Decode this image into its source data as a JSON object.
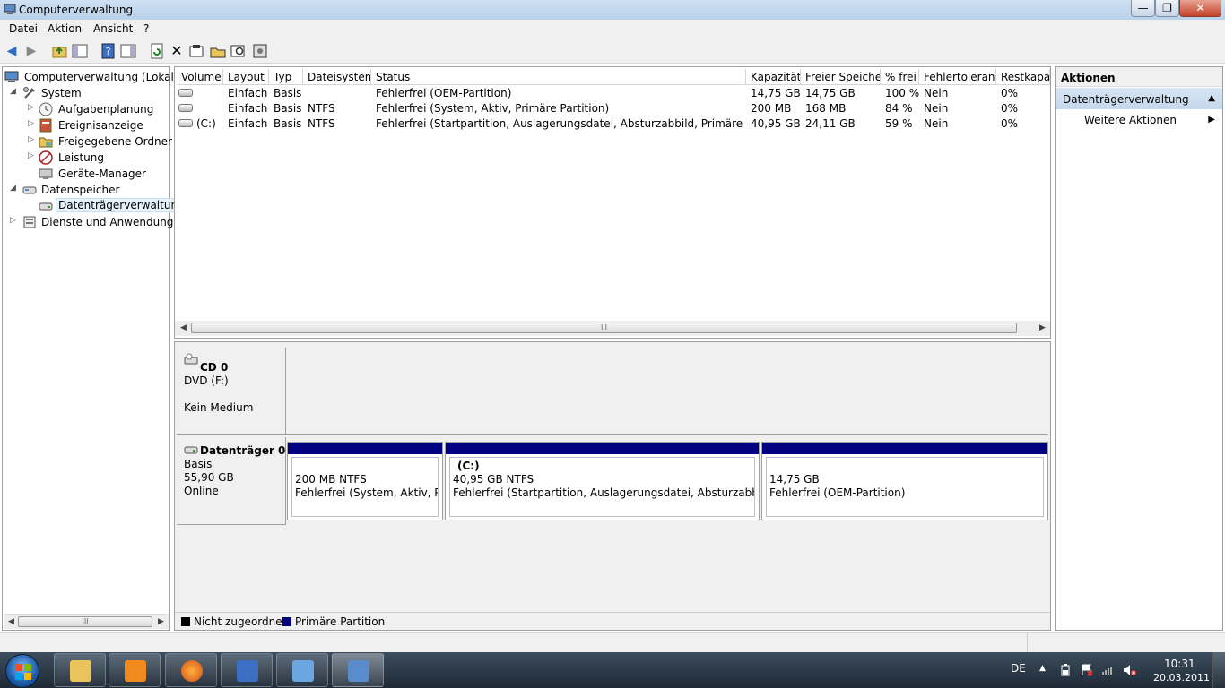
{
  "window": {
    "title": "Computerverwaltung",
    "close_glyph": "✕",
    "min_glyph": "—",
    "max_glyph": "❐"
  },
  "menu": [
    "Datei",
    "Aktion",
    "Ansicht",
    "?"
  ],
  "toolbar": {
    "icons": [
      "back-arrow-icon",
      "forward-arrow-icon",
      "folder-up-icon",
      "show-hide-console-tree-icon",
      "help-icon",
      "show-hide-action-pane-icon",
      "refresh-icon",
      "delete-icon",
      "properties-icon",
      "open-folder-icon",
      "search-icon",
      "settings-icon"
    ]
  },
  "tree": {
    "root": "Computerverwaltung (Lokal)",
    "system": "System",
    "aufgabenplanung": "Aufgabenplanung",
    "ereignisanzeige": "Ereignisanzeige",
    "freigegebene_ordner": "Freigegebene Ordner",
    "leistung": "Leistung",
    "geraete_manager": "Geräte-Manager",
    "datenspeicher": "Datenspeicher",
    "datentraegerverwaltung": "Datenträgerverwaltung",
    "dienste": "Dienste und Anwendungen",
    "scroll_thumb": "III"
  },
  "volumes": {
    "columns": [
      "Volume",
      "Layout",
      "Typ",
      "Dateisystem",
      "Status",
      "Kapazität",
      "Freier Speicher",
      "% frei",
      "Fehlertoleranz",
      "Restkapazi"
    ],
    "rows": [
      {
        "volume": "",
        "layout": "Einfach",
        "typ": "Basis",
        "fs": "",
        "status": "Fehlerfrei (OEM-Partition)",
        "kap": "14,75 GB",
        "frei": "14,75 GB",
        "pct": "100 %",
        "fehler": "Nein",
        "rest": "0%"
      },
      {
        "volume": "",
        "layout": "Einfach",
        "typ": "Basis",
        "fs": "NTFS",
        "status": "Fehlerfrei (System, Aktiv, Primäre Partition)",
        "kap": "200 MB",
        "frei": "168 MB",
        "pct": "84 %",
        "fehler": "Nein",
        "rest": "0%"
      },
      {
        "volume": "(C:)",
        "layout": "Einfach",
        "typ": "Basis",
        "fs": "NTFS",
        "status": "Fehlerfrei (Startpartition, Auslagerungsdatei, Absturzabbild, Primäre Partition)",
        "kap": "40,95 GB",
        "frei": "24,11 GB",
        "pct": "59 %",
        "fehler": "Nein",
        "rest": "0%"
      }
    ],
    "scroll_thumb": "III"
  },
  "disks": {
    "cd": {
      "name": "CD 0",
      "type": "DVD (F:)",
      "status": "Kein Medium"
    },
    "disk0": {
      "name": "Datenträger 0",
      "type": "Basis",
      "size": "55,90 GB",
      "status": "Online"
    },
    "partitions": [
      {
        "label": "",
        "size": "200 MB NTFS",
        "status": "Fehlerfrei (System, Aktiv, Primäre Partition)"
      },
      {
        "label": "(C:)",
        "size": "40,95 GB NTFS",
        "status": "Fehlerfrei (Startpartition, Auslagerungsdatei, Absturzabbild, Primäre Partition)"
      },
      {
        "label": "",
        "size": "14,75 GB",
        "status": "Fehlerfrei (OEM-Partition)"
      }
    ],
    "partition_color": "#000080",
    "legend": [
      {
        "label": "Nicht zugeordnet",
        "color": "#000000"
      },
      {
        "label": "Primäre Partition",
        "color": "#000080"
      }
    ]
  },
  "actions": {
    "title": "Aktionen",
    "section": "Datenträgerverwaltung",
    "more": "Weitere Aktionen"
  },
  "taskbar": {
    "apps": [
      "explorer-icon",
      "media-player-icon",
      "firefox-icon",
      "network-icon",
      "control-panel-icon",
      "computer-management-icon"
    ],
    "lang": "DE",
    "time": "10:31",
    "date": "20.03.2011"
  }
}
